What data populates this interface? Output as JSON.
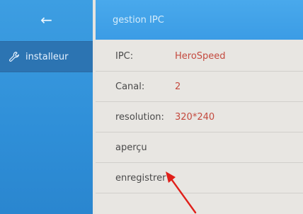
{
  "sidebar": {
    "back_icon": "←",
    "items": [
      {
        "label": "installeur",
        "icon": "wrench-icon"
      }
    ]
  },
  "header": {
    "title": "gestion IPC"
  },
  "settings": [
    {
      "label": "IPC:",
      "value": "HeroSpeed"
    },
    {
      "label": "Canal:",
      "value": "2"
    },
    {
      "label": "resolution:",
      "value": "320*240"
    },
    {
      "label": "aperçu"
    },
    {
      "label": "enregistrer"
    }
  ],
  "colors": {
    "sidebar": "#2f8fd8",
    "sidebar_selected": "#2c74b2",
    "header": "#3b9ce5",
    "value_text": "#c44a3f",
    "annotation_arrow": "#e0201a"
  }
}
